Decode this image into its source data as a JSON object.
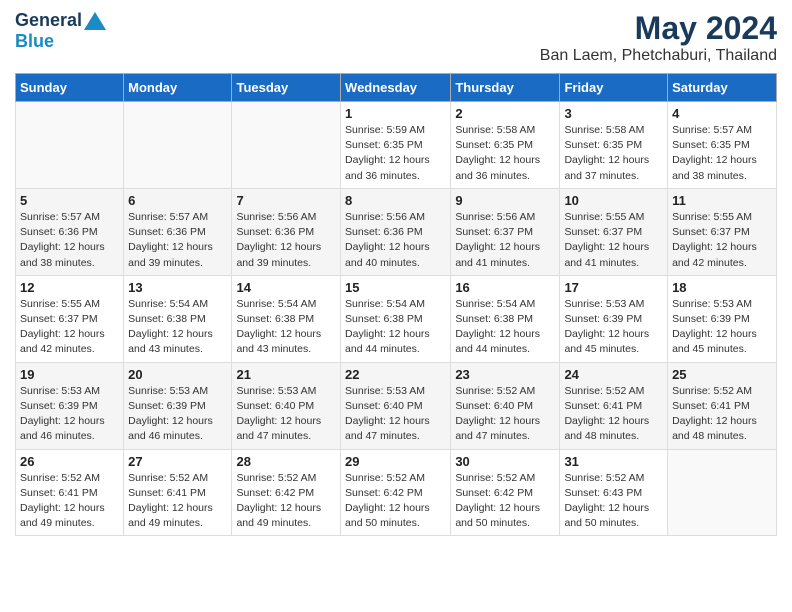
{
  "logo": {
    "general": "General",
    "blue": "Blue"
  },
  "title": "May 2024",
  "subtitle": "Ban Laem, Phetchaburi, Thailand",
  "headers": [
    "Sunday",
    "Monday",
    "Tuesday",
    "Wednesday",
    "Thursday",
    "Friday",
    "Saturday"
  ],
  "weeks": [
    [
      {
        "day": "",
        "sunrise": "",
        "sunset": "",
        "daylight": ""
      },
      {
        "day": "",
        "sunrise": "",
        "sunset": "",
        "daylight": ""
      },
      {
        "day": "",
        "sunrise": "",
        "sunset": "",
        "daylight": ""
      },
      {
        "day": "1",
        "sunrise": "Sunrise: 5:59 AM",
        "sunset": "Sunset: 6:35 PM",
        "daylight": "Daylight: 12 hours and 36 minutes."
      },
      {
        "day": "2",
        "sunrise": "Sunrise: 5:58 AM",
        "sunset": "Sunset: 6:35 PM",
        "daylight": "Daylight: 12 hours and 36 minutes."
      },
      {
        "day": "3",
        "sunrise": "Sunrise: 5:58 AM",
        "sunset": "Sunset: 6:35 PM",
        "daylight": "Daylight: 12 hours and 37 minutes."
      },
      {
        "day": "4",
        "sunrise": "Sunrise: 5:57 AM",
        "sunset": "Sunset: 6:35 PM",
        "daylight": "Daylight: 12 hours and 38 minutes."
      }
    ],
    [
      {
        "day": "5",
        "sunrise": "Sunrise: 5:57 AM",
        "sunset": "Sunset: 6:36 PM",
        "daylight": "Daylight: 12 hours and 38 minutes."
      },
      {
        "day": "6",
        "sunrise": "Sunrise: 5:57 AM",
        "sunset": "Sunset: 6:36 PM",
        "daylight": "Daylight: 12 hours and 39 minutes."
      },
      {
        "day": "7",
        "sunrise": "Sunrise: 5:56 AM",
        "sunset": "Sunset: 6:36 PM",
        "daylight": "Daylight: 12 hours and 39 minutes."
      },
      {
        "day": "8",
        "sunrise": "Sunrise: 5:56 AM",
        "sunset": "Sunset: 6:36 PM",
        "daylight": "Daylight: 12 hours and 40 minutes."
      },
      {
        "day": "9",
        "sunrise": "Sunrise: 5:56 AM",
        "sunset": "Sunset: 6:37 PM",
        "daylight": "Daylight: 12 hours and 41 minutes."
      },
      {
        "day": "10",
        "sunrise": "Sunrise: 5:55 AM",
        "sunset": "Sunset: 6:37 PM",
        "daylight": "Daylight: 12 hours and 41 minutes."
      },
      {
        "day": "11",
        "sunrise": "Sunrise: 5:55 AM",
        "sunset": "Sunset: 6:37 PM",
        "daylight": "Daylight: 12 hours and 42 minutes."
      }
    ],
    [
      {
        "day": "12",
        "sunrise": "Sunrise: 5:55 AM",
        "sunset": "Sunset: 6:37 PM",
        "daylight": "Daylight: 12 hours and 42 minutes."
      },
      {
        "day": "13",
        "sunrise": "Sunrise: 5:54 AM",
        "sunset": "Sunset: 6:38 PM",
        "daylight": "Daylight: 12 hours and 43 minutes."
      },
      {
        "day": "14",
        "sunrise": "Sunrise: 5:54 AM",
        "sunset": "Sunset: 6:38 PM",
        "daylight": "Daylight: 12 hours and 43 minutes."
      },
      {
        "day": "15",
        "sunrise": "Sunrise: 5:54 AM",
        "sunset": "Sunset: 6:38 PM",
        "daylight": "Daylight: 12 hours and 44 minutes."
      },
      {
        "day": "16",
        "sunrise": "Sunrise: 5:54 AM",
        "sunset": "Sunset: 6:38 PM",
        "daylight": "Daylight: 12 hours and 44 minutes."
      },
      {
        "day": "17",
        "sunrise": "Sunrise: 5:53 AM",
        "sunset": "Sunset: 6:39 PM",
        "daylight": "Daylight: 12 hours and 45 minutes."
      },
      {
        "day": "18",
        "sunrise": "Sunrise: 5:53 AM",
        "sunset": "Sunset: 6:39 PM",
        "daylight": "Daylight: 12 hours and 45 minutes."
      }
    ],
    [
      {
        "day": "19",
        "sunrise": "Sunrise: 5:53 AM",
        "sunset": "Sunset: 6:39 PM",
        "daylight": "Daylight: 12 hours and 46 minutes."
      },
      {
        "day": "20",
        "sunrise": "Sunrise: 5:53 AM",
        "sunset": "Sunset: 6:39 PM",
        "daylight": "Daylight: 12 hours and 46 minutes."
      },
      {
        "day": "21",
        "sunrise": "Sunrise: 5:53 AM",
        "sunset": "Sunset: 6:40 PM",
        "daylight": "Daylight: 12 hours and 47 minutes."
      },
      {
        "day": "22",
        "sunrise": "Sunrise: 5:53 AM",
        "sunset": "Sunset: 6:40 PM",
        "daylight": "Daylight: 12 hours and 47 minutes."
      },
      {
        "day": "23",
        "sunrise": "Sunrise: 5:52 AM",
        "sunset": "Sunset: 6:40 PM",
        "daylight": "Daylight: 12 hours and 47 minutes."
      },
      {
        "day": "24",
        "sunrise": "Sunrise: 5:52 AM",
        "sunset": "Sunset: 6:41 PM",
        "daylight": "Daylight: 12 hours and 48 minutes."
      },
      {
        "day": "25",
        "sunrise": "Sunrise: 5:52 AM",
        "sunset": "Sunset: 6:41 PM",
        "daylight": "Daylight: 12 hours and 48 minutes."
      }
    ],
    [
      {
        "day": "26",
        "sunrise": "Sunrise: 5:52 AM",
        "sunset": "Sunset: 6:41 PM",
        "daylight": "Daylight: 12 hours and 49 minutes."
      },
      {
        "day": "27",
        "sunrise": "Sunrise: 5:52 AM",
        "sunset": "Sunset: 6:41 PM",
        "daylight": "Daylight: 12 hours and 49 minutes."
      },
      {
        "day": "28",
        "sunrise": "Sunrise: 5:52 AM",
        "sunset": "Sunset: 6:42 PM",
        "daylight": "Daylight: 12 hours and 49 minutes."
      },
      {
        "day": "29",
        "sunrise": "Sunrise: 5:52 AM",
        "sunset": "Sunset: 6:42 PM",
        "daylight": "Daylight: 12 hours and 50 minutes."
      },
      {
        "day": "30",
        "sunrise": "Sunrise: 5:52 AM",
        "sunset": "Sunset: 6:42 PM",
        "daylight": "Daylight: 12 hours and 50 minutes."
      },
      {
        "day": "31",
        "sunrise": "Sunrise: 5:52 AM",
        "sunset": "Sunset: 6:43 PM",
        "daylight": "Daylight: 12 hours and 50 minutes."
      },
      {
        "day": "",
        "sunrise": "",
        "sunset": "",
        "daylight": ""
      }
    ]
  ]
}
